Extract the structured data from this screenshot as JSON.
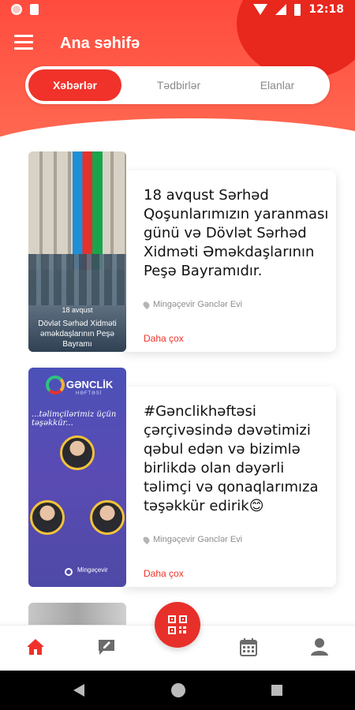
{
  "status_bar": {
    "time": "12:18"
  },
  "header": {
    "title": "Ana səhifə"
  },
  "tabs": [
    {
      "label": "Xəbərlər",
      "active": true
    },
    {
      "label": "Tədbirlər",
      "active": false
    },
    {
      "label": "Elanlar",
      "active": false
    }
  ],
  "news": [
    {
      "title": "18 avqust Sərhəd Qoşunlarımızın yaranması günü və Dövlət Sərhəd Xidməti Əməkdaşlarının Peşə Bayramıdır.",
      "location": "Mingəçevir Gənclər Evi",
      "more": "Daha çox",
      "image_caption_1": "18 avqust",
      "image_caption_2": "Dövlət Sərhəd Xidməti əməkdaşlarının Peşə Bayramı"
    },
    {
      "title": "#Gənclikhəftəsi çərçivəsində dəvətimizi qəbul edən və bizimlə birlikdə olan dəyərli təlimçi və qonaqlarımıza təşəkkür edirik😊",
      "location": "Mingəçevir Gənclər Evi",
      "more": "Daha çox",
      "image_brand": "GƏNCLİK",
      "image_brand_sub": "HƏFTƏSİ",
      "image_script": "...təlimçilərimiz üçün təşəkkür...",
      "image_footer": "Mingəçevir"
    }
  ],
  "icons": {
    "menu": "hamburger-icon",
    "home": "home-icon",
    "chat": "chat-edit-icon",
    "qr": "qr-code-icon",
    "calendar": "calendar-icon",
    "profile": "profile-icon"
  },
  "colors": {
    "accent": "#f0322a",
    "header": "#ff4b3e"
  }
}
